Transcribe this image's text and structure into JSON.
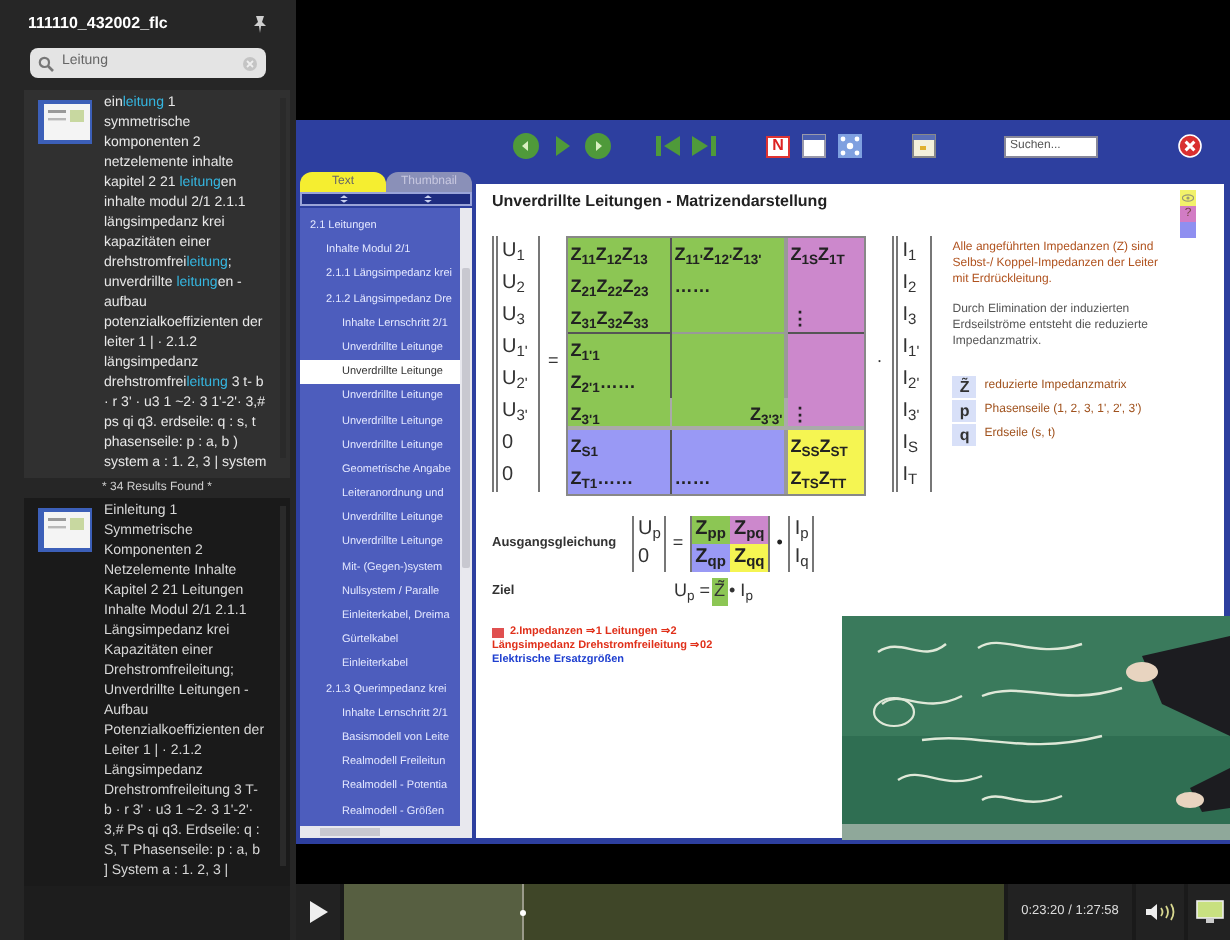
{
  "sidebar": {
    "title": "111110_432002_flc",
    "search": {
      "value": "Leitung"
    },
    "results": [
      {
        "selected": true,
        "lines": [
          [
            {
              "t": "ein",
              "hit": false
            },
            {
              "t": "leitung",
              "hit": true
            },
            {
              "t": " 1",
              "hit": false
            }
          ],
          [
            {
              "t": "symmetrische",
              "hit": false
            }
          ],
          [
            {
              "t": "komponenten 2",
              "hit": false
            }
          ],
          [
            {
              "t": "netzelemente inhalte",
              "hit": false
            }
          ],
          [
            {
              "t": "kapitel 2 21 ",
              "hit": false
            },
            {
              "t": "leitung",
              "hit": true
            },
            {
              "t": "en",
              "hit": false
            }
          ],
          [
            {
              "t": "inhalte modul 2/1 2.1.1",
              "hit": false
            }
          ],
          [
            {
              "t": "längsimpedanz krei",
              "hit": false
            }
          ],
          [
            {
              "t": "kapazitäten einer",
              "hit": false
            }
          ],
          [
            {
              "t": "drehstromfrei",
              "hit": false
            },
            {
              "t": "leitung",
              "hit": true
            },
            {
              "t": ";",
              "hit": false
            }
          ],
          [
            {
              "t": "unverdrillte ",
              "hit": false
            },
            {
              "t": "leitung",
              "hit": true
            },
            {
              "t": "en -",
              "hit": false
            }
          ],
          [
            {
              "t": "aufbau",
              "hit": false
            }
          ],
          [
            {
              "t": "potenzialkoeffizienten der",
              "hit": false
            }
          ],
          [
            {
              "t": "leiter 1 |  · 2.1.2",
              "hit": false
            }
          ],
          [
            {
              "t": "längsimpedanz",
              "hit": false
            }
          ],
          [
            {
              "t": "drehstromfrei",
              "hit": false
            },
            {
              "t": "leitung",
              "hit": true
            },
            {
              "t": " 3 t- b",
              "hit": false
            }
          ],
          [
            {
              "t": " · r 3' · u3 1 ~2· 3 1'-2'· 3,#",
              "hit": false
            }
          ],
          [
            {
              "t": "ps qi q3. erdseile: q : s, t",
              "hit": false
            }
          ],
          [
            {
              "t": "phasenseile: p : a, b )",
              "hit": false
            }
          ],
          [
            {
              "t": "system a : 1. 2, 3 | system",
              "hit": false
            }
          ]
        ]
      },
      {
        "selected": false,
        "lines": [
          [
            {
              "t": "Einleitung 1",
              "hit": false
            }
          ],
          [
            {
              "t": "Symmetrische",
              "hit": false
            }
          ],
          [
            {
              "t": "Komponenten 2",
              "hit": false
            }
          ],
          [
            {
              "t": "Netzelemente Inhalte",
              "hit": false
            }
          ],
          [
            {
              "t": "Kapitel 2 21 Leitungen",
              "hit": false
            }
          ],
          [
            {
              "t": "Inhalte Modul 2/1 2.1.1",
              "hit": false
            }
          ],
          [
            {
              "t": "Längsimpedanz krei",
              "hit": false
            }
          ],
          [
            {
              "t": "Kapazitäten einer",
              "hit": false
            }
          ],
          [
            {
              "t": "Drehstromfreileitung;",
              "hit": false
            }
          ],
          [
            {
              "t": "Unverdrillte Leitungen -",
              "hit": false
            }
          ],
          [
            {
              "t": "Aufbau",
              "hit": false
            }
          ],
          [
            {
              "t": "Potenzialkoeffizienten der",
              "hit": false
            }
          ],
          [
            {
              "t": "Leiter 1 |  · 2.1.2",
              "hit": false
            }
          ],
          [
            {
              "t": "Längsimpedanz",
              "hit": false
            }
          ],
          [
            {
              "t": "Drehstromfreileitung 3 T-",
              "hit": false
            }
          ],
          [
            {
              "t": "b  · r 3' · u3 1 ~2· 3 1'-2'·",
              "hit": false
            }
          ],
          [
            {
              "t": "3,# Ps qi q3. Erdseile: q :",
              "hit": false
            }
          ],
          [
            {
              "t": "S, T Phasenseile: p : a, b",
              "hit": false
            }
          ],
          [
            {
              "t": "] System a : 1. 2, 3 |",
              "hit": false
            }
          ]
        ]
      }
    ],
    "results_found": "* 34 Results Found *"
  },
  "presentation": {
    "toolbar": {
      "n_label": "N",
      "search": {
        "placeholder": "Suchen..."
      }
    },
    "nav": {
      "tabs": [
        {
          "label": "Text",
          "selected": true
        },
        {
          "label": "Thumbnail",
          "selected": false
        }
      ],
      "tree": [
        {
          "label": "2.1 Leitungen",
          "selected": false,
          "children": [
            {
              "label": "Inhalte Modul 2/1",
              "selected": false
            },
            {
              "label": "2.1.1 Längsimpedanz krei",
              "selected": false
            },
            {
              "label": "2.1.2 Längsimpedanz Dre",
              "selected": false,
              "children": [
                {
                  "label": "Inhalte Lernschritt 2/1",
                  "selected": false
                },
                {
                  "label": "Unverdrillte Leitunge",
                  "selected": false
                },
                {
                  "label": "Unverdrillte Leitunge",
                  "selected": true
                },
                {
                  "label": "Unverdrillte Leitunge",
                  "selected": false
                },
                {
                  "label": "Unverdrillte Leitunge",
                  "selected": false
                },
                {
                  "label": "Unverdrillte Leitunge",
                  "selected": false
                },
                {
                  "label": "Geometrische Angabe",
                  "selected": false
                },
                {
                  "label": "Leiteranordnung und",
                  "selected": false
                },
                {
                  "label": "Unverdrillte Leitunge",
                  "selected": false
                },
                {
                  "label": "Unverdrillte Leitunge",
                  "selected": false
                },
                {
                  "label": "Mit- (Gegen-)system",
                  "selected": false
                },
                {
                  "label": "Nullsystem / Paralle",
                  "selected": false
                },
                {
                  "label": "Einleiterkabel, Dreima",
                  "selected": false
                },
                {
                  "label": "Gürtelkabel",
                  "selected": false
                },
                {
                  "label": "Einleiterkabel",
                  "selected": false
                }
              ]
            },
            {
              "label": "2.1.3 Querimpedanz krei",
              "selected": false,
              "children": [
                {
                  "label": "Inhalte Lernschritt 2/1",
                  "selected": false
                },
                {
                  "label": "Basismodell von Leite",
                  "selected": false
                },
                {
                  "label": "Realmodell Freileitun",
                  "selected": false
                },
                {
                  "label": "Realmodell - Potentia",
                  "selected": false
                },
                {
                  "label": "Realmodell - Größen",
                  "selected": false
                }
              ]
            }
          ]
        }
      ]
    },
    "slide": {
      "title": "Unverdrillte Leitungen - Matrizendarstellung",
      "markers": [
        {
          "color": "#f2f26a",
          "kind": "eye"
        },
        {
          "color": "#d27cc4",
          "kind": "help",
          "text": "?"
        },
        {
          "color": "#8f8ff0",
          "kind": "plain"
        }
      ],
      "u_vector": [
        "U$_{1}$",
        "U$_{2}$",
        "U$_{3}$",
        "U$_{1'}$",
        "U$_{2'}$",
        "U$_{3'}$",
        "0",
        "0"
      ],
      "equals": "=",
      "matrix": [
        {
          "cells": [
            {
              "text": "Z$_{11}$Z$_{12}$Z$_{13}$",
              "color": "#8cc654"
            },
            {
              "text": "Z$_{11'}$Z$_{12'}$Z$_{13'}$",
              "color": "#8cc654"
            },
            {
              "text": "Z$_{1S}$Z$_{1T}$",
              "color": "#cc88cc"
            }
          ]
        },
        {
          "cells": [
            {
              "text": "Z$_{21}$Z$_{22}$Z$_{23}$",
              "color": "#8cc654"
            },
            {
              "text": "……",
              "color": "#8cc654"
            },
            {
              "color": "#cc88cc"
            }
          ]
        },
        {
          "cells": [
            {
              "text": "Z$_{31}$Z$_{32}$Z$_{33}$",
              "color": "#8cc654"
            },
            {
              "color": "#8cc654"
            },
            {
              "text": "⋮",
              "color": "#cc88cc"
            }
          ]
        },
        {
          "cells": [
            {
              "text": "Z$_{1'1}$",
              "color": "#8cc654"
            },
            {
              "color": "#8cc654"
            },
            {
              "color": "#cc88cc"
            }
          ]
        },
        {
          "cells": [
            {
              "text": "Z$_{2'1}$……",
              "color": "#8cc654"
            },
            {
              "color": "#8cc654"
            },
            {
              "color": "#cc88cc"
            }
          ]
        },
        {
          "cells": [
            {
              "text": "Z$_{3'1}$",
              "color": "#8cc654"
            },
            {
              "text": "Z$_{3'3'}$",
              "color": "#8cc654"
            },
            {
              "text": "⋮",
              "color": "#cc88cc"
            }
          ]
        },
        {
          "cells": [
            {
              "text": "Z$_{S1}$",
              "color": "#9999f5"
            },
            {
              "color": "#9999f5"
            },
            {
              "text": "Z$_{SS}$Z$_{ST}$",
              "color": "#f5f552"
            }
          ]
        },
        {
          "cells": [
            {
              "text": "Z$_{T1}$……",
              "color": "#9999f5"
            },
            {
              "text": "……",
              "color": "#9999f5"
            },
            {
              "text": "Z$_{TS}$Z$_{TT}$",
              "color": "#f5f552"
            }
          ]
        }
      ],
      "dot": "·",
      "i_vector": [
        "I$_{1}$",
        "I$_{2}$",
        "I$_{3}$",
        "I$_{1'}$",
        "I$_{2'}$",
        "I$_{3'}$",
        "I$_{S}$",
        "I$_{T}$"
      ],
      "notes": [
        {
          "text": "Alle angeführten Impedanzen (Z) sind Selbst-/ Koppel-Impedanzen der Leiter mit Erdrückleitung.",
          "color": "#b0521e"
        },
        {
          "text": "Durch Elimination der induzierten Erdseilströme entsteht die reduzierte Impedanzmatrix.",
          "color": "#555555"
        }
      ],
      "symbols": [
        {
          "symbol": "Z̃",
          "text": "reduzierte Impedanzmatrix"
        },
        {
          "symbol": "p",
          "text": "Phasenseile (1, 2, 3, 1', 2', 3')"
        },
        {
          "symbol": "q",
          "text": "Erdseile (s, t)"
        }
      ],
      "initial_equation": {
        "label": "Ausgangsgleichung",
        "lhs": [
          "U$_{p}$",
          "0"
        ],
        "equals": "=",
        "cells": [
          {
            "text": "Z$_{pp}$",
            "color": "#8cc654"
          },
          {
            "text": "Z$_{pq}$",
            "color": "#cc88cc"
          },
          {
            "text": "Z$_{qp}$",
            "color": "#9999f5"
          },
          {
            "text": "Z$_{qq}$",
            "color": "#f5f552"
          }
        ],
        "dot": "•",
        "rhs": [
          "I$_{p}$",
          "I$_{q}$"
        ]
      },
      "goal": {
        "label": "Ziel",
        "parts": [
          {
            "text": "U$_{p}$ ="
          },
          {
            "text": "Z̃",
            "color": "#8cc654"
          },
          {
            "text": "• I$_{p}$"
          }
        ]
      },
      "breadcrumb": [
        {
          "text": "2.Impedanzen ⇒1 Leitungen ⇒2",
          "color": "#e0301a"
        },
        {
          "text": "Längsimpedanz Drehstromfreileitung ⇒02",
          "color": "#e0301a"
        },
        {
          "text": "Elektrische Ersatzgrößen",
          "color": "#2040d0"
        }
      ]
    }
  },
  "player": {
    "playing": false,
    "level": 0.27,
    "time": "0:23:20 / 1:27:58"
  }
}
